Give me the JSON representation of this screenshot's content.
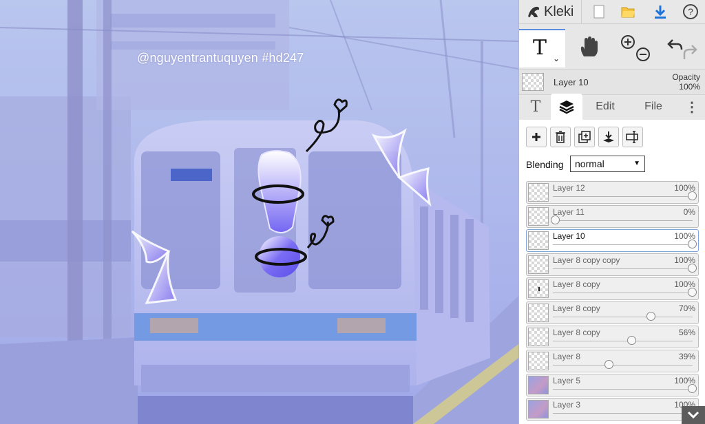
{
  "canvas": {
    "watermark": "@nguyentrantuquyen  #hd247"
  },
  "app": {
    "name": "Kleki"
  },
  "topbar": {
    "icons": [
      "kleki-logo-icon",
      "new-file-icon",
      "open-folder-icon",
      "download-icon",
      "help-icon"
    ]
  },
  "tools": {
    "text_tool": "T",
    "icons": [
      "text-tool-icon",
      "hand-tool-icon",
      "zoom-in-icon",
      "zoom-out-icon",
      "undo-icon",
      "redo-icon"
    ]
  },
  "current_layer": {
    "name": "Layer 10",
    "opacity_label": "Opacity",
    "opacity_value": "100%"
  },
  "tabs": [
    {
      "label": "T",
      "icon": "text-tab-icon"
    },
    {
      "label": "",
      "icon": "layers-tab-icon"
    },
    {
      "label": "Edit"
    },
    {
      "label": "File"
    },
    {
      "label": "⋮",
      "icon": "more-menu-icon"
    }
  ],
  "layer_tools": [
    "add-layer-icon",
    "delete-layer-icon",
    "duplicate-layer-icon",
    "merge-down-icon",
    "rename-layer-icon"
  ],
  "blending": {
    "label": "Blending",
    "value": "normal"
  },
  "layers": [
    {
      "name": "Layer 12",
      "opacity": "100%",
      "value": 1.0,
      "thumb": "empty"
    },
    {
      "name": "Layer 11",
      "opacity": "0%",
      "value": 0.0,
      "thumb": "empty"
    },
    {
      "name": "Layer 10",
      "opacity": "100%",
      "value": 1.0,
      "thumb": "empty",
      "selected": true
    },
    {
      "name": "Layer 8 copy copy",
      "opacity": "100%",
      "value": 1.0,
      "thumb": "empty"
    },
    {
      "name": "Layer 8 copy",
      "opacity": "100%",
      "value": 1.0,
      "thumb": "mark"
    },
    {
      "name": "Layer 8 copy",
      "opacity": "70%",
      "value": 0.7,
      "thumb": "empty"
    },
    {
      "name": "Layer 8 copy",
      "opacity": "56%",
      "value": 0.56,
      "thumb": "empty"
    },
    {
      "name": "Layer 8",
      "opacity": "39%",
      "value": 0.39,
      "thumb": "empty"
    },
    {
      "name": "Layer 5",
      "opacity": "100%",
      "value": 1.0,
      "thumb": "photo"
    },
    {
      "name": "Layer 3",
      "opacity": "100%",
      "value": 1.0,
      "thumb": "photo"
    }
  ],
  "colors": {
    "accent": "#5a8de0",
    "exclamation": "#7a6ef0",
    "arrow": "#8c80f2"
  }
}
